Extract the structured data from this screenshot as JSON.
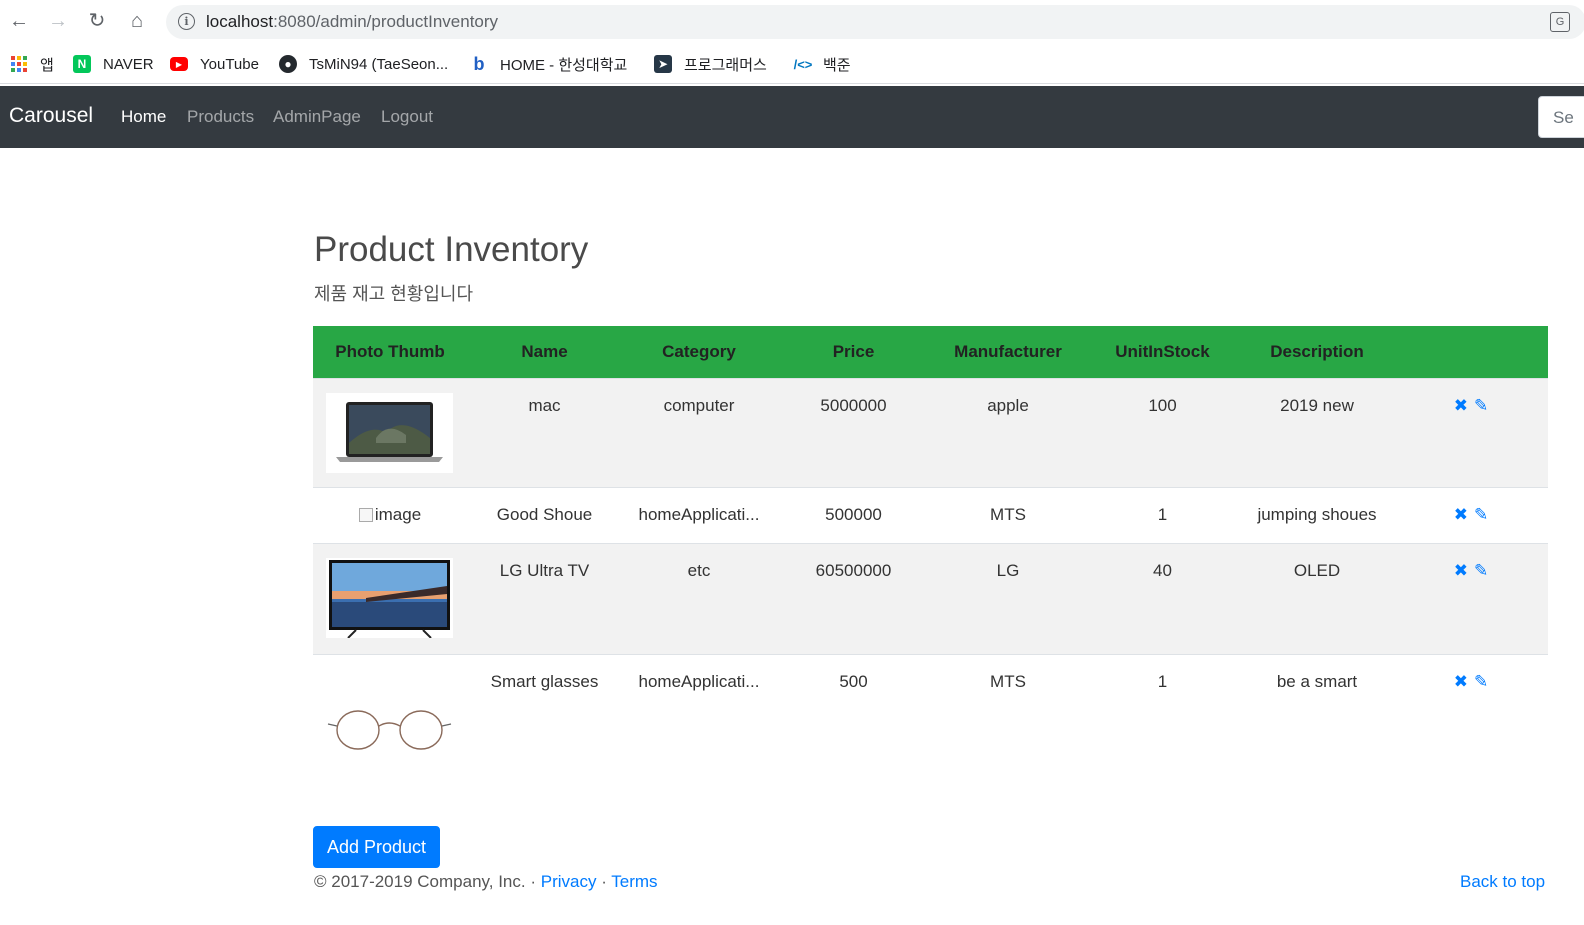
{
  "browser": {
    "url_host": "localhost",
    "url_path": ":8080/admin/productInventory",
    "bookmarks": [
      {
        "label": "앱",
        "icon": "apps-grid-icon",
        "color": "#e94235"
      },
      {
        "label": "NAVER",
        "icon": "naver-icon",
        "color": "#03c75a"
      },
      {
        "label": "YouTube",
        "icon": "youtube-icon",
        "color": "#ff0000"
      },
      {
        "label": "TsMiN94 (TaeSeon...",
        "icon": "github-icon",
        "color": "#24292e"
      },
      {
        "label": "HOME - 한성대학교",
        "icon": "bing-icon",
        "color": "#2160c4"
      },
      {
        "label": "프로그래머스",
        "icon": "programmers-icon",
        "color": "#263747"
      },
      {
        "label": "백준",
        "icon": "code-brackets-icon",
        "color": "#0076c0"
      }
    ]
  },
  "navbar": {
    "brand": "Carousel",
    "links": [
      "Home",
      "Products",
      "AdminPage",
      "Logout"
    ],
    "search_placeholder": "Se"
  },
  "page": {
    "title": "Product Inventory",
    "subtitle": "제품 재고 현황입니다"
  },
  "table": {
    "headers": [
      "Photo Thumb",
      "Name",
      "Category",
      "Price",
      "Manufacturer",
      "UnitInStock",
      "Description",
      ""
    ],
    "rows": [
      {
        "thumb": "laptop",
        "name": "mac",
        "category": "computer",
        "price": "5000000",
        "manufacturer": "apple",
        "stock": "100",
        "description": "2019 new"
      },
      {
        "thumb": "broken",
        "thumb_alt": "image",
        "name": "Good Shoue",
        "category": "homeApplicati...",
        "price": "500000",
        "manufacturer": "MTS",
        "stock": "1",
        "description": "jumping shoues"
      },
      {
        "thumb": "tv",
        "name": "LG Ultra TV",
        "category": "etc",
        "price": "60500000",
        "manufacturer": "LG",
        "stock": "40",
        "description": "OLED"
      },
      {
        "thumb": "glasses",
        "name": "Smart glasses",
        "category": "homeApplicati...",
        "price": "500",
        "manufacturer": "MTS",
        "stock": "1",
        "description": "be a smart"
      }
    ],
    "delete_icon": "✖",
    "edit_icon": "✎"
  },
  "actions": {
    "add_label": "Add Product"
  },
  "footer": {
    "copyright": "© 2017-2019 Company, Inc. · ",
    "privacy": "Privacy",
    "sep": " · ",
    "terms": "Terms",
    "back_to_top": "Back to top"
  },
  "colors": {
    "navbar": "#343a40",
    "table_header": "#28a745",
    "primary": "#007bff"
  }
}
